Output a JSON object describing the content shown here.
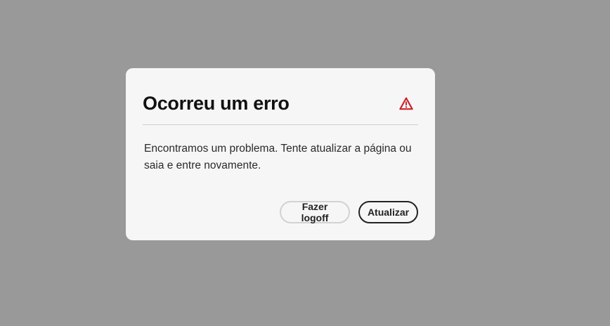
{
  "dialog": {
    "title": "Ocorreu um erro",
    "icon": "alert-triangle-icon",
    "icon_color": "#c9252d",
    "message": "Encontramos um problema. Tente atualizar a página ou saia e entre novamente.",
    "buttons": {
      "logoff_label": "Fazer logoff",
      "refresh_label": "Atualizar"
    }
  },
  "colors": {
    "overlay": "#999999",
    "dialog_bg": "#f6f6f6",
    "alert": "#c9252d"
  }
}
